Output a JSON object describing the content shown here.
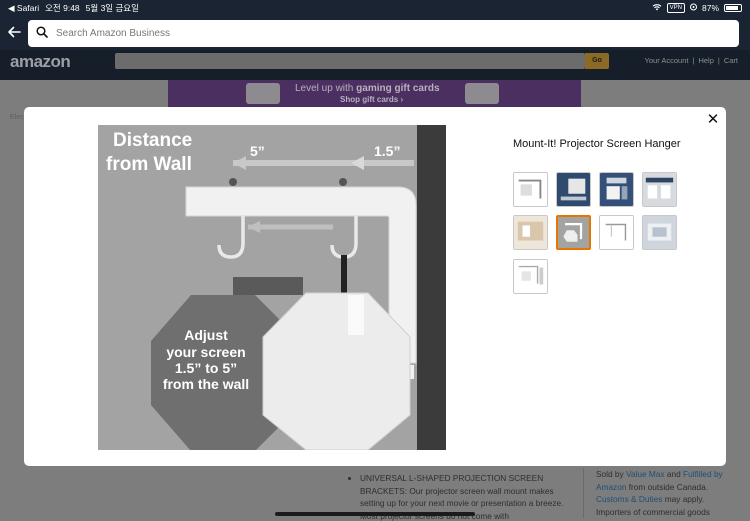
{
  "status_bar": {
    "carrier": "◀ Safari",
    "time": "오전 9:48",
    "date": "5월 3일 금요일",
    "vpn": "VPN",
    "battery": "87%",
    "battery_level": 0.87
  },
  "address_bar": {
    "search_placeholder": "Search Amazon Business"
  },
  "background_page": {
    "logo": "amazon",
    "go_label": "Go",
    "nav": [
      "Your Account",
      "|",
      "Help",
      "|",
      "Cart"
    ],
    "banner_title_prefix": "Level up with ",
    "banner_title_bold": "gaming gift cards",
    "banner_cta": "Shop gift cards ›",
    "crumb": "Elec",
    "bullet_1": "UNIVERSAL L-SHAPED PROJECTION SCREEN BRACKETS: Our projector screen wall mount makes setting up for your next movie or presentation a breeze. Most projector screens do not come with",
    "sold_prefix": "Sold by ",
    "sold_seller": "Value Max",
    "sold_and": " and ",
    "sold_fulfilled": "Fulfilled by Amazon",
    "sold_from": " from outside Canada.",
    "customs_link": "Customs & Duties",
    "customs_rest": " may apply.",
    "importers": "Importers of commercial goods"
  },
  "modal": {
    "title": "Mount-It! Projector Screen Hanger",
    "close_label": "✕",
    "main_image": {
      "heading_line1": "Distance",
      "heading_line2": "from Wall",
      "label_5": "5”",
      "label_15": "1.5”",
      "adjust_line1": "Adjust",
      "adjust_line2": "your screen",
      "adjust_line3": "1.5” to 5”",
      "adjust_line4": "from the wall"
    },
    "thumbnails": [
      {
        "name": "thumb-1",
        "selected": false
      },
      {
        "name": "thumb-2",
        "selected": false
      },
      {
        "name": "thumb-3",
        "selected": false
      },
      {
        "name": "thumb-4",
        "selected": false
      },
      {
        "name": "thumb-5",
        "selected": false
      },
      {
        "name": "thumb-6",
        "selected": true
      },
      {
        "name": "thumb-7",
        "selected": false
      },
      {
        "name": "thumb-8",
        "selected": false
      },
      {
        "name": "thumb-9",
        "selected": false
      }
    ]
  },
  "colors": {
    "accent_selected": "#e77600",
    "status_bg": "#1b2433",
    "image_grey": "#a3a3a3",
    "dark_octagon": "#6f6f6f",
    "wall": "#3b3b3b"
  }
}
